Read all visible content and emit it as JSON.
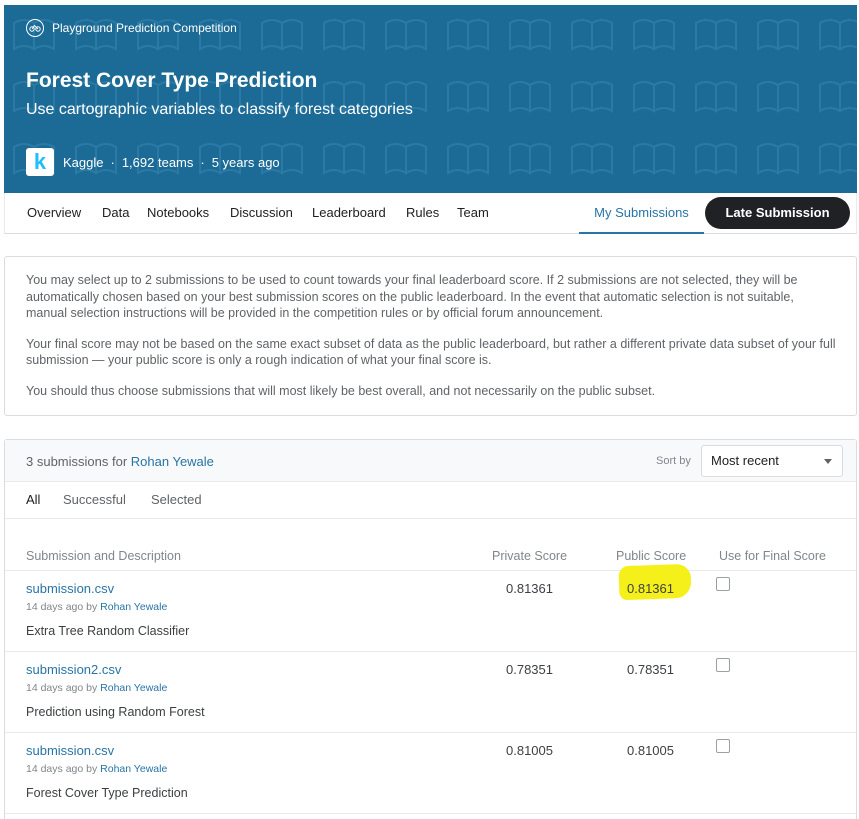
{
  "banner": {
    "competition_type": "Playground Prediction Competition",
    "title": "Forest Cover Type Prediction",
    "subtitle": "Use cartographic variables to classify forest categories",
    "host": "Kaggle",
    "host_logo_letter": "k",
    "teams": "1,692 teams",
    "age": "5 years ago",
    "separator": "·",
    "bg_color": "#1c6b96"
  },
  "nav": {
    "overview": "Overview",
    "data": "Data",
    "notebooks": "Notebooks",
    "discussion": "Discussion",
    "leaderboard": "Leaderboard",
    "rules": "Rules",
    "team": "Team",
    "my_submissions": "My Submissions",
    "late_submission": "Late Submission"
  },
  "info": {
    "p1": "You may select up to 2 submissions to be used to count towards your final leaderboard score. If 2 submissions are not selected, they will be automatically chosen based on your best submission scores on the public leaderboard. In the event that automatic selection is not suitable, manual selection instructions will be provided in the competition rules or by official forum announcement.",
    "p2": "Your final score may not be based on the same exact subset of data as the public leaderboard, but rather a different private data subset of your full submission — your public score is only a rough indication of what your final score is.",
    "p3": "You should thus choose submissions that will most likely be best overall, and not necessarily on the public subset."
  },
  "submissions": {
    "count_text": "3 submissions for",
    "user": "Rohan Yewale",
    "sort_label": "Sort by",
    "sort_value": "Most recent",
    "filters": {
      "all": "All",
      "successful": "Successful",
      "selected": "Selected"
    },
    "columns": {
      "submission": "Submission and Description",
      "private": "Private Score",
      "public": "Public Score",
      "final": "Use for Final Score"
    },
    "rows": [
      {
        "file": "submission.csv",
        "age": "14 days ago by",
        "user": "Rohan Yewale",
        "description": "Extra Tree Random Classifier",
        "private": "0.81361",
        "public": "0.81361",
        "highlighted": true
      },
      {
        "file": "submission2.csv",
        "age": "14 days ago by",
        "user": "Rohan Yewale",
        "description": "Prediction using Random Forest",
        "private": "0.78351",
        "public": "0.78351",
        "highlighted": false
      },
      {
        "file": "submission.csv",
        "age": "14 days ago by",
        "user": "Rohan Yewale",
        "description": "Forest Cover Type Prediction",
        "private": "0.81005",
        "public": "0.81005",
        "highlighted": false
      }
    ]
  }
}
